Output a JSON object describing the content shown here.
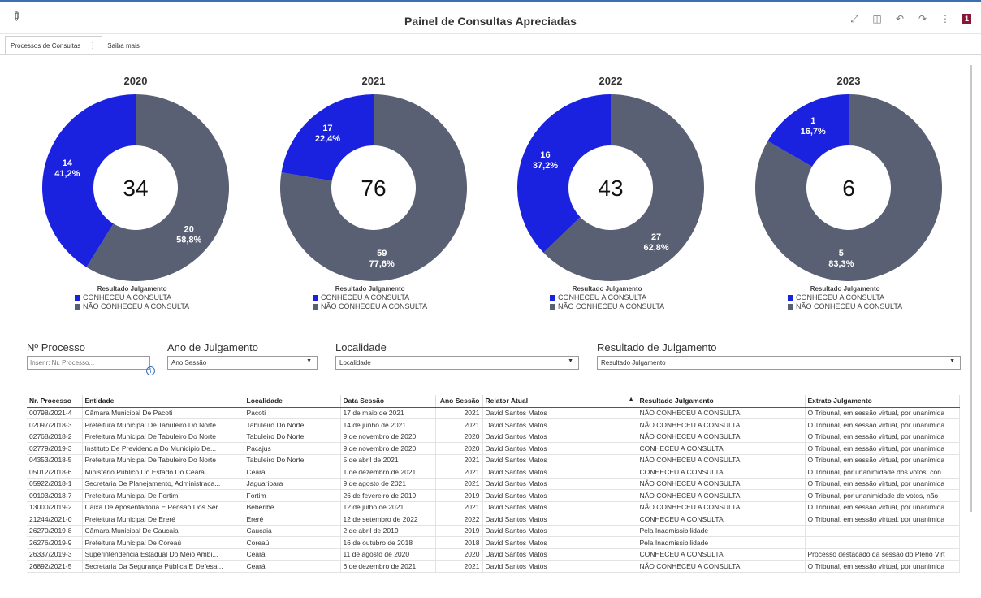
{
  "header": {
    "title": "Painel de Consultas Apreciadas",
    "edit_icon": "pencil-icon",
    "badge": "1"
  },
  "tabs": [
    {
      "label": "Processos de Consultas"
    },
    {
      "label": "Saiba mais"
    }
  ],
  "colors": {
    "conheceu": "#1a22e0",
    "nao_conheceu": "#5a6074",
    "accent": "#3a6fb5"
  },
  "chart_data": [
    {
      "type": "pie",
      "title": "2020",
      "total": "34",
      "legend_title": "Resultado Julgamento",
      "categories": [
        "CONHECEU A CONSULTA",
        "NÃO CONHECEU A CONSULTA"
      ],
      "values": [
        14,
        20
      ],
      "labels": [
        "14\n41,2%",
        "20\n58,8%"
      ]
    },
    {
      "type": "pie",
      "title": "2021",
      "total": "76",
      "legend_title": "Resultado Julgamento",
      "categories": [
        "CONHECEU A CONSULTA",
        "NÃO CONHECEU A CONSULTA"
      ],
      "values": [
        17,
        59
      ],
      "labels": [
        "17\n22,4%",
        "59\n77,6%"
      ]
    },
    {
      "type": "pie",
      "title": "2022",
      "total": "43",
      "legend_title": "Resultado Julgamento",
      "categories": [
        "CONHECEU A CONSULTA",
        "NÃO CONHECEU A CONSULTA"
      ],
      "values": [
        16,
        27
      ],
      "labels": [
        "16\n37,2%",
        "27\n62,8%"
      ]
    },
    {
      "type": "pie",
      "title": "2023",
      "total": "6",
      "legend_title": "Resultado Julgamento",
      "categories": [
        "CONHECEU A CONSULTA",
        "NÃO CONHECEU A CONSULTA"
      ],
      "values": [
        1,
        5
      ],
      "labels": [
        "1\n16,7%",
        "5\n83,3%"
      ]
    }
  ],
  "filters": {
    "processo_label": "Nº Processo",
    "processo_placeholder": "Inserir: Nr. Processo...",
    "ano_label": "Ano de Julgamento",
    "ano_value": "Ano Sessão",
    "localidade_label": "Localidade",
    "localidade_value": "Localidade",
    "resultado_label": "Resultado de Julgamento",
    "resultado_value": "Resultado Julgamento"
  },
  "table": {
    "columns": [
      "Nr. Processo",
      "Entidade",
      "Localidade",
      "Data Sessão",
      "Ano Sessão",
      "Relator Atual",
      "Resultado Julgamento",
      "Extrato Julgamento"
    ],
    "rows": [
      [
        "00798/2021-4",
        "Câmara Municipal De Pacoti",
        "Pacoti",
        "17 de maio de 2021",
        "2021",
        "David Santos Matos",
        "NÃO CONHECEU A CONSULTA",
        "O Tribunal, em sessão virtual, por unanimida"
      ],
      [
        "02097/2018-3",
        "Prefeitura Municipal De Tabuleiro Do Norte",
        "Tabuleiro Do Norte",
        "14 de junho de 2021",
        "2021",
        "David Santos Matos",
        "NÃO CONHECEU A CONSULTA",
        "O Tribunal, em sessão virtual, por unanimida"
      ],
      [
        "02768/2018-2",
        "Prefeitura Municipal De Tabuleiro Do Norte",
        "Tabuleiro Do Norte",
        "9 de novembro de 2020",
        "2020",
        "David Santos Matos",
        "NÃO CONHECEU A CONSULTA",
        "O Tribunal, em sessão virtual, por unanimida"
      ],
      [
        "02779/2019-3",
        "Instituto De Previdencia Do Municipio De...",
        "Pacajus",
        "9 de novembro de 2020",
        "2020",
        "David Santos Matos",
        "CONHECEU A CONSULTA",
        "O Tribunal, em sessão virtual, por unanimida"
      ],
      [
        "04353/2018-5",
        "Prefeitura Municipal De Tabuleiro Do Norte",
        "Tabuleiro Do Norte",
        "5 de abril de 2021",
        "2021",
        "David Santos Matos",
        "NÃO CONHECEU A CONSULTA",
        "O Tribunal, em sessão virtual, por unanimida"
      ],
      [
        "05012/2018-6",
        "Ministério Público Do Estado Do Ceará",
        "Ceará",
        "1 de dezembro de 2021",
        "2021",
        "David Santos Matos",
        "CONHECEU A CONSULTA",
        "O Tribunal, por unanimidade dos votos, con"
      ],
      [
        "05922/2018-1",
        "Secretaria De Planejamento, Administraca...",
        "Jaguaribara",
        "9 de agosto de 2021",
        "2021",
        "David Santos Matos",
        "NÃO CONHECEU A CONSULTA",
        "O Tribunal, em sessão virtual, por unanimida"
      ],
      [
        "09103/2018-7",
        "Prefeitura Municipal De Fortim",
        "Fortim",
        "26 de fevereiro de 2019",
        "2019",
        "David Santos Matos",
        "NÃO CONHECEU A CONSULTA",
        "O Tribunal, por unanimidade de votos, não"
      ],
      [
        "13000/2019-2",
        "Caixa De Aposentadoria E Pensão Dos Ser...",
        "Beberibe",
        "12 de julho de 2021",
        "2021",
        "David Santos Matos",
        "NÃO CONHECEU A CONSULTA",
        "O Tribunal, em sessão virtual, por unanimida"
      ],
      [
        "21244/2021-0",
        "Prefeitura Municipal De Ereré",
        "Ereré",
        "12 de setembro de 2022",
        "2022",
        "David Santos Matos",
        "CONHECEU A CONSULTA",
        "O Tribunal, em sessão virtual, por unanimida"
      ],
      [
        "26270/2019-8",
        "Câmara Municipal De Caucaia",
        "Caucaia",
        "2 de abril de 2019",
        "2019",
        "David Santos Matos",
        "Pela Inadmissibilidade",
        ""
      ],
      [
        "26276/2019-9",
        "Prefeitura Municipal De Coreaú",
        "Coreaú",
        "16 de outubro de 2018",
        "2018",
        "David Santos Matos",
        "Pela Inadmissibilidade",
        ""
      ],
      [
        "26337/2019-3",
        "Superintendência Estadual Do Meio Ambi...",
        "Ceará",
        "11 de agosto de 2020",
        "2020",
        "David Santos Matos",
        "CONHECEU A CONSULTA",
        "Processo destacado da sessão do Pleno Virt"
      ],
      [
        "26892/2021-5",
        "Secretaria Da Segurança Pública E Defesa...",
        "Ceará",
        "6 de dezembro de 2021",
        "2021",
        "David Santos Matos",
        "NÃO CONHECEU A CONSULTA",
        "O Tribunal, em sessão virtual, por unanimida"
      ]
    ]
  }
}
